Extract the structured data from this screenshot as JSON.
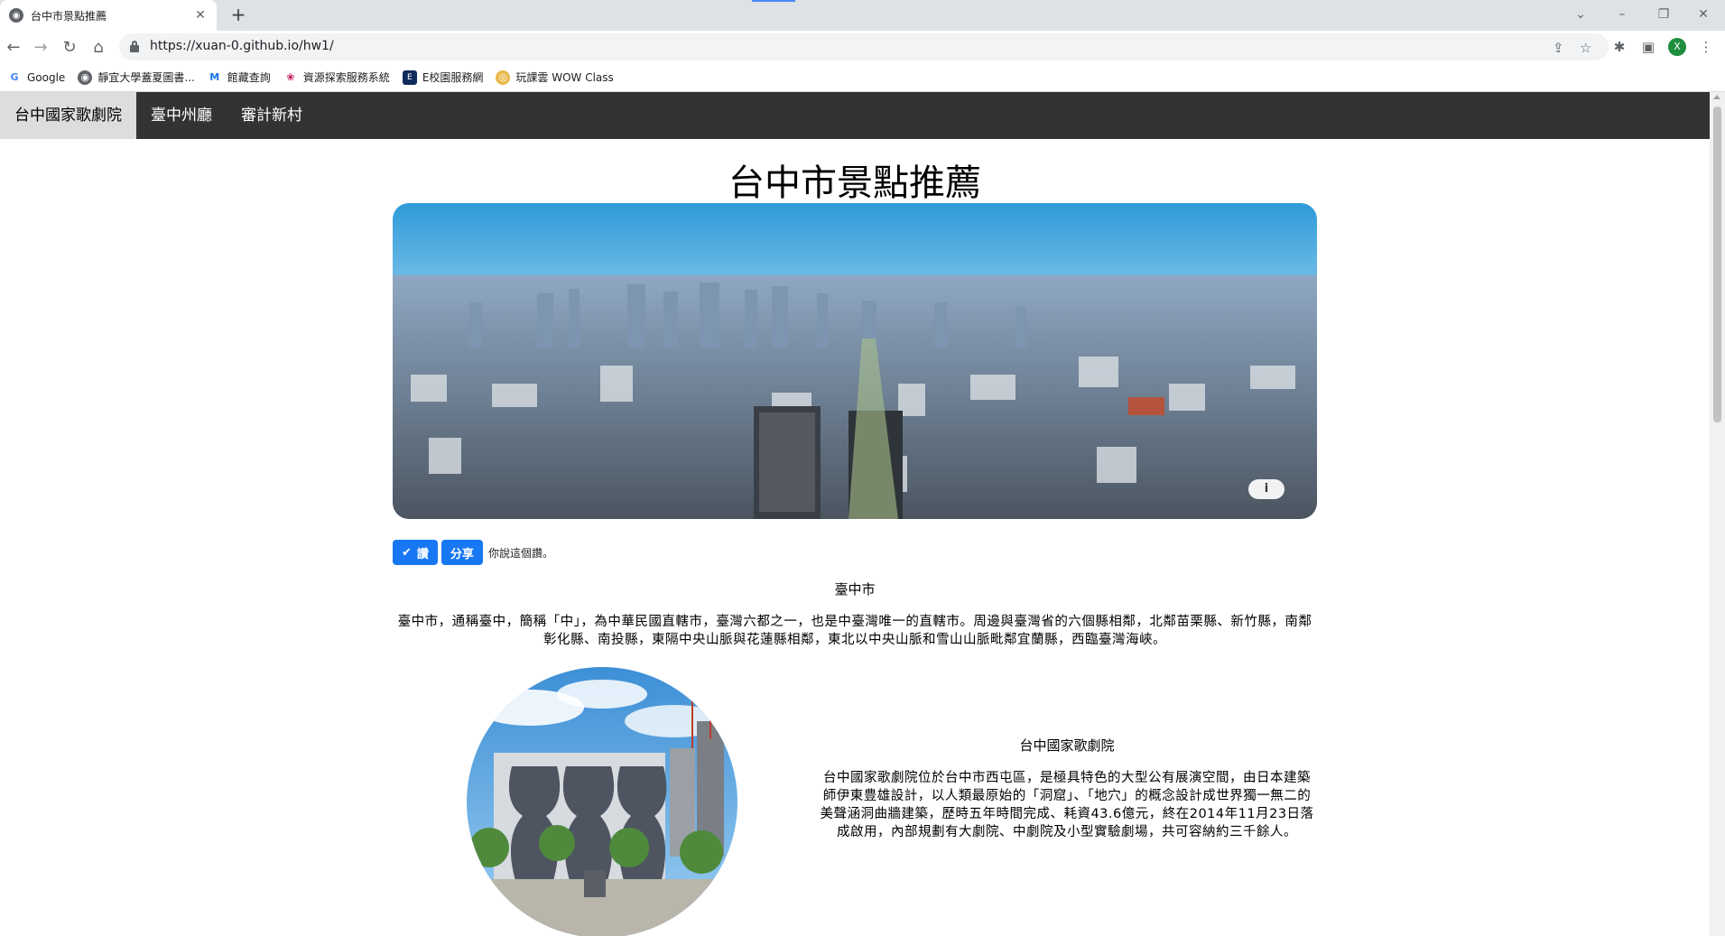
{
  "browser": {
    "tab_title": "台中市景點推薦",
    "new_tab_icon": "plus-icon",
    "url": "https://xuan-0.github.io/hw1/",
    "profile_initial": "X",
    "bookmarks": [
      {
        "label": "Google",
        "icon": "google-icon"
      },
      {
        "label": "靜宜大學蓋夏圖書...",
        "icon": "globe-icon"
      },
      {
        "label": "館藏查詢",
        "icon": "library-icon"
      },
      {
        "label": "資源探索服務系統",
        "icon": "resource-icon"
      },
      {
        "label": "E校園服務網",
        "icon": "campus-icon"
      },
      {
        "label": "玩課雲 WOW Class",
        "icon": "wowclass-icon"
      }
    ]
  },
  "nav": {
    "items": [
      "台中國家歌劇院",
      "臺中州廳",
      "審計新村"
    ]
  },
  "page": {
    "title": "台中市景點推薦",
    "hero_info": "i",
    "fb_like": "讚",
    "fb_share": "分享",
    "fb_text": "你說這個讚。",
    "sections": [
      {
        "heading": "臺中市",
        "body": "臺中市，通稱臺中，簡稱「中」，為中華民國直轄市，臺灣六都之一，也是中臺灣唯一的直轄市。周邊與臺灣省的六個縣相鄰，北鄰苗栗縣、新竹縣，南鄰彰化縣、南投縣，東隔中央山脈與花蓮縣相鄰，東北以中央山脈和雪山山脈毗鄰宜蘭縣，西臨臺灣海峽。"
      },
      {
        "heading": "台中國家歌劇院",
        "body": "台中國家歌劇院位於台中市西屯區，是極具特色的大型公有展演空間，由日本建築師伊東豊雄設計，以人類最原始的「洞窟」、「地穴」的概念設計成世界獨一無二的美聲涵洞曲牆建築，歷時五年時間完成、耗資43.6億元，終在2014年11月23日落成啟用，內部規劃有大劇院、中劇院及小型實驗劇場，共可容納約三千餘人。"
      }
    ]
  }
}
